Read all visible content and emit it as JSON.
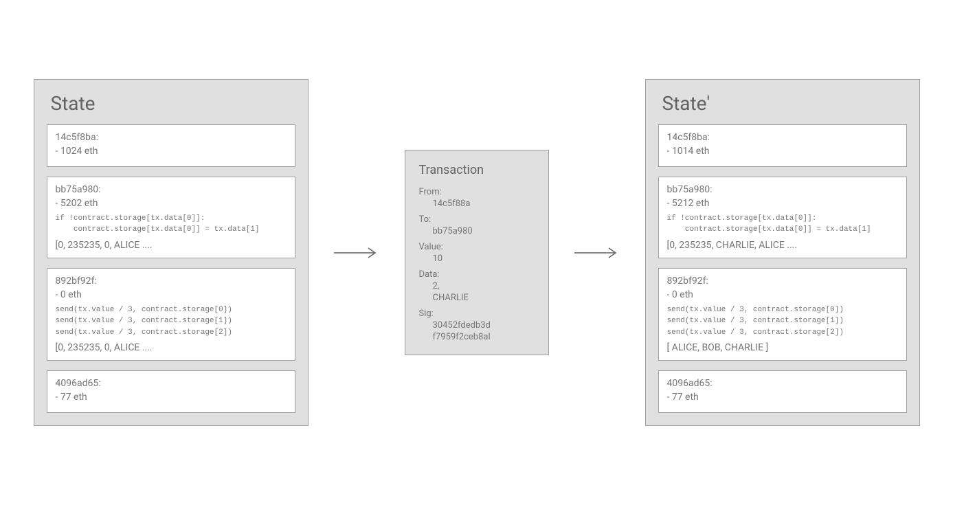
{
  "stateBefore": {
    "title": "State",
    "accounts": [
      {
        "addr": "14c5f8ba:",
        "balance": "- 1024 eth"
      },
      {
        "addr": "bb75a980:",
        "balance": "- 5202 eth",
        "code": "if !contract.storage[tx.data[0]]:\n    contract.storage[tx.data[0]] = tx.data[1]",
        "storage": "[0, 235235, 0, ALICE ...."
      },
      {
        "addr": "892bf92f:",
        "balance": "- 0 eth",
        "code": "send(tx.value / 3, contract.storage[0])\nsend(tx.value / 3, contract.storage[1])\nsend(tx.value / 3, contract.storage[2])",
        "storage": "[0, 235235, 0, ALICE ...."
      },
      {
        "addr": "4096ad65:",
        "balance": "- 77 eth"
      }
    ]
  },
  "transaction": {
    "title": "Transaction",
    "fromLabel": "From:",
    "fromValue": "14c5f88a",
    "toLabel": "To:",
    "toValue": "bb75a980",
    "valueLabel": "Value:",
    "valueValue": "10",
    "dataLabel": "Data:",
    "dataValue1": "2,",
    "dataValue2": "CHARLIE",
    "sigLabel": "Sig:",
    "sigValue1": "30452fdedb3d",
    "sigValue2": "f7959f2ceb8al"
  },
  "stateAfter": {
    "title": "State'",
    "accounts": [
      {
        "addr": "14c5f8ba:",
        "balance": "- 1014 eth"
      },
      {
        "addr": "bb75a980:",
        "balance": "- 5212 eth",
        "code": "if !contract.storage[tx.data[0]]:\n    contract.storage[tx.data[0]] = tx.data[1]",
        "storage": "[0, 235235, CHARLIE, ALICE ...."
      },
      {
        "addr": "892bf92f:",
        "balance": "- 0 eth",
        "code": "send(tx.value / 3, contract.storage[0])\nsend(tx.value / 3, contract.storage[1])\nsend(tx.value / 3, contract.storage[2])",
        "storage": "[ ALICE, BOB, CHARLIE ]"
      },
      {
        "addr": "4096ad65:",
        "balance": "- 77 eth"
      }
    ]
  }
}
